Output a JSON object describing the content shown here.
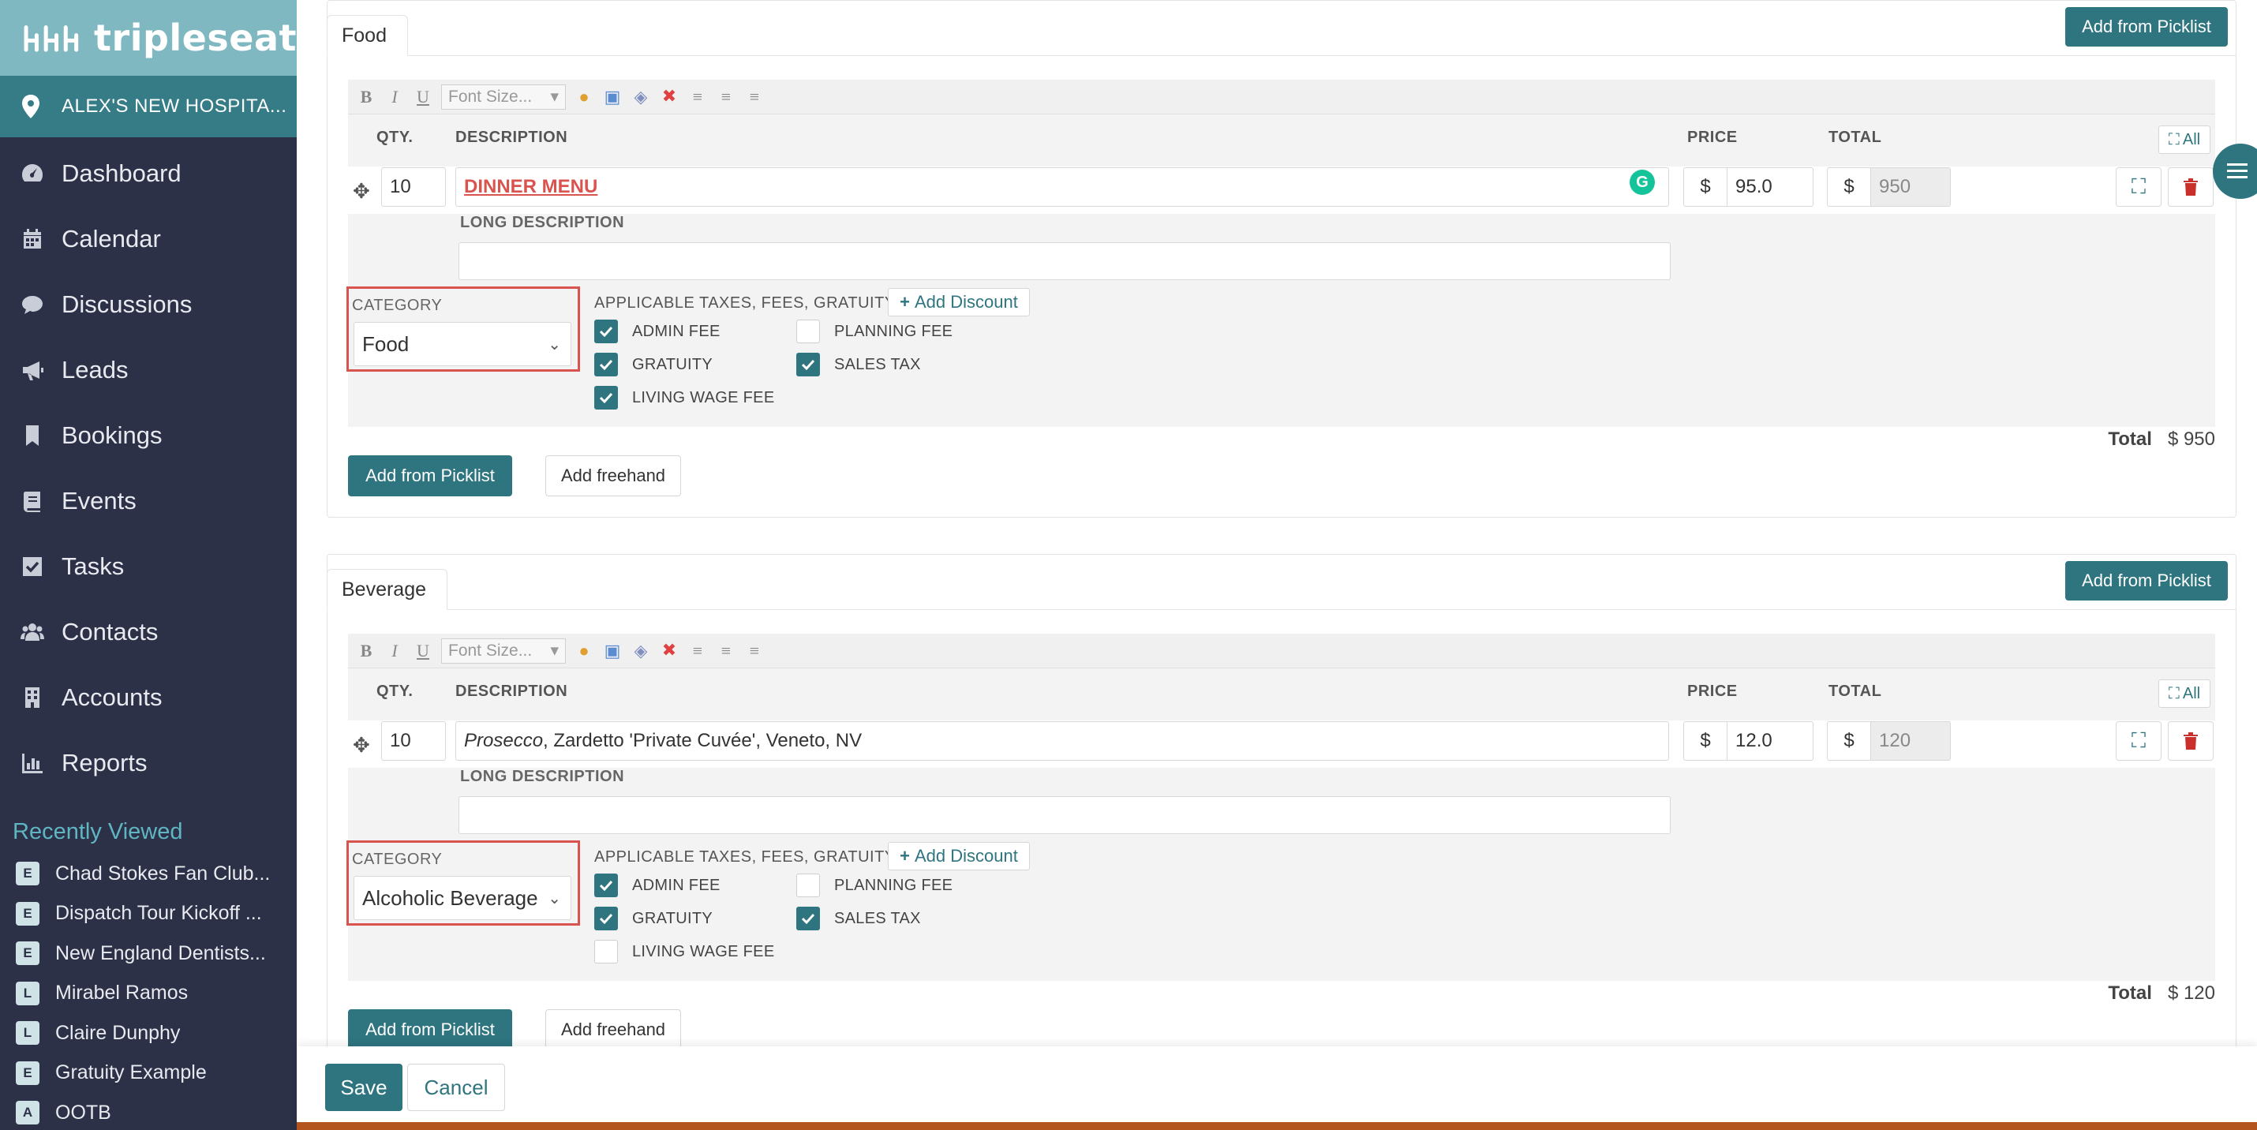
{
  "brand": {
    "name": "tripleseat"
  },
  "venue": {
    "name": "ALEX'S NEW HOSPITA..."
  },
  "nav": [
    {
      "label": "Dashboard",
      "icon": "gauge-icon"
    },
    {
      "label": "Calendar",
      "icon": "calendar-icon"
    },
    {
      "label": "Discussions",
      "icon": "chat-icon"
    },
    {
      "label": "Leads",
      "icon": "megaphone-icon"
    },
    {
      "label": "Bookings",
      "icon": "bookmark-icon"
    },
    {
      "label": "Events",
      "icon": "book-icon"
    },
    {
      "label": "Tasks",
      "icon": "checkbox-icon"
    },
    {
      "label": "Contacts",
      "icon": "users-icon"
    },
    {
      "label": "Accounts",
      "icon": "building-icon"
    },
    {
      "label": "Reports",
      "icon": "bar-chart-icon"
    }
  ],
  "recent": {
    "title": "Recently Viewed",
    "items": [
      {
        "badge": "E",
        "label": "Chad Stokes Fan Club..."
      },
      {
        "badge": "E",
        "label": "Dispatch Tour Kickoff ..."
      },
      {
        "badge": "E",
        "label": "New England Dentists..."
      },
      {
        "badge": "L",
        "label": "Mirabel Ramos"
      },
      {
        "badge": "L",
        "label": "Claire Dunphy"
      },
      {
        "badge": "E",
        "label": "Gratuity Example"
      },
      {
        "badge": "A",
        "label": "OOTB"
      }
    ]
  },
  "common": {
    "add_from_picklist": "Add from Picklist",
    "add_freehand": "Add freehand",
    "font_size": "Font Size...",
    "qty_header": "QTY.",
    "desc_header": "DESCRIPTION",
    "price_header": "PRICE",
    "total_header": "TOTAL",
    "all_label": "All",
    "long_desc": "LONG DESCRIPTION",
    "category_label": "CATEGORY",
    "taxes_label": "APPLICABLE TAXES, FEES, GRATUITY, ETC.",
    "add_discount": "Add Discount",
    "currency": "$",
    "total_label": "Total",
    "tb_bold": "B",
    "tb_italic": "I",
    "tb_underline": "U",
    "fee_admin": "ADMIN FEE",
    "fee_planning": "PLANNING FEE",
    "fee_gratuity": "GRATUITY",
    "fee_sales_tax": "SALES TAX",
    "fee_living_wage": "LIVING WAGE FEE"
  },
  "food": {
    "tab": "Food",
    "qty": "10",
    "description": "DINNER MENU",
    "price": "95.0",
    "line_total": "950",
    "category": "Food",
    "section_total": "$ 950",
    "fees": {
      "admin": true,
      "planning": false,
      "gratuity": true,
      "sales_tax": true,
      "living_wage": true
    }
  },
  "beverage": {
    "tab": "Beverage",
    "qty": "10",
    "description_italic": "Prosecco",
    "description_rest": ", Zardetto 'Private Cuvée', Veneto, NV",
    "price": "12.0",
    "line_total": "120",
    "category": "Alcoholic Beverage",
    "section_total": "$ 120",
    "fees": {
      "admin": true,
      "planning": false,
      "gratuity": true,
      "sales_tax": true,
      "living_wage": false
    }
  },
  "footer": {
    "save": "Save",
    "cancel": "Cancel"
  },
  "colors": {
    "sidebar": "#2c3147",
    "brand": "#7fb8c0",
    "venue": "#357c86",
    "primary": "#2f7580",
    "highlight": "#d9534f"
  }
}
